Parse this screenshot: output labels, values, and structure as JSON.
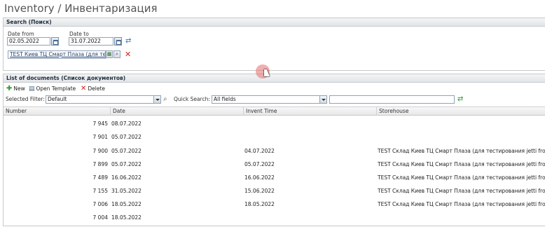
{
  "page": {
    "title": "Inventory / Инвентаризация"
  },
  "search": {
    "header": "Search (Поиск)",
    "date_from_label": "Date from",
    "date_from_value": "02.05.2022",
    "date_to_label": "Date to",
    "date_to_value": "31.07.2022",
    "store_value": "TEST Киев ТЦ Смарт Плаза (для тес"
  },
  "documents": {
    "header": "List of documents (Список документов)",
    "toolbar": {
      "new_label": "New",
      "open_template_label": "Open Template",
      "delete_label": "Delete"
    },
    "filter": {
      "selected_filter_label": "Selected Filter:",
      "selected_filter_value": "Default",
      "quick_search_label": "Quick Search:",
      "quick_search_field": "All fields",
      "quick_search_text": ""
    },
    "columns": [
      "Number",
      "Date",
      "Invent Time",
      "Storehouse"
    ],
    "rows": [
      {
        "number": "7 945",
        "date": "08.07.2022",
        "invent_time": "",
        "storehouse": ""
      },
      {
        "number": "7 901",
        "date": "05.07.2022",
        "invent_time": "",
        "storehouse": ""
      },
      {
        "number": "7 900",
        "date": "05.07.2022",
        "invent_time": "04.07.2022",
        "storehouse": "TEST Склад Киев ТЦ Смарт Плаза (для тестирования jetti front)"
      },
      {
        "number": "7 899",
        "date": "05.07.2022",
        "invent_time": "05.07.2022",
        "storehouse": "TEST Склад Киев ТЦ Смарт Плаза (для тестирования jetti front)"
      },
      {
        "number": "7 489",
        "date": "16.06.2022",
        "invent_time": "16.06.2022",
        "storehouse": "TEST Склад Киев ТЦ Смарт Плаза (для тестирования jetti front)"
      },
      {
        "number": "7 155",
        "date": "31.05.2022",
        "invent_time": "15.06.2022",
        "storehouse": "TEST Склад Киев ТЦ Смарт Плаза (для тестирования jetti front)"
      },
      {
        "number": "7 006",
        "date": "18.05.2022",
        "invent_time": "18.05.2022",
        "storehouse": "TEST Склад Киев ТЦ Смарт Плаза (для тестирования jetti front)"
      },
      {
        "number": "7 004",
        "date": "18.05.2022",
        "invent_time": "",
        "storehouse": ""
      }
    ]
  },
  "icons": {
    "calendar": "calendar-icon",
    "refresh": "refresh-icon",
    "new": "plus-icon",
    "open_template": "template-icon",
    "delete": "delete-icon",
    "search": "magnifier-icon"
  },
  "colors": {
    "delete_red": "#d0231c",
    "new_green": "#2f9a2f",
    "link_blue": "#1f3b6a"
  }
}
